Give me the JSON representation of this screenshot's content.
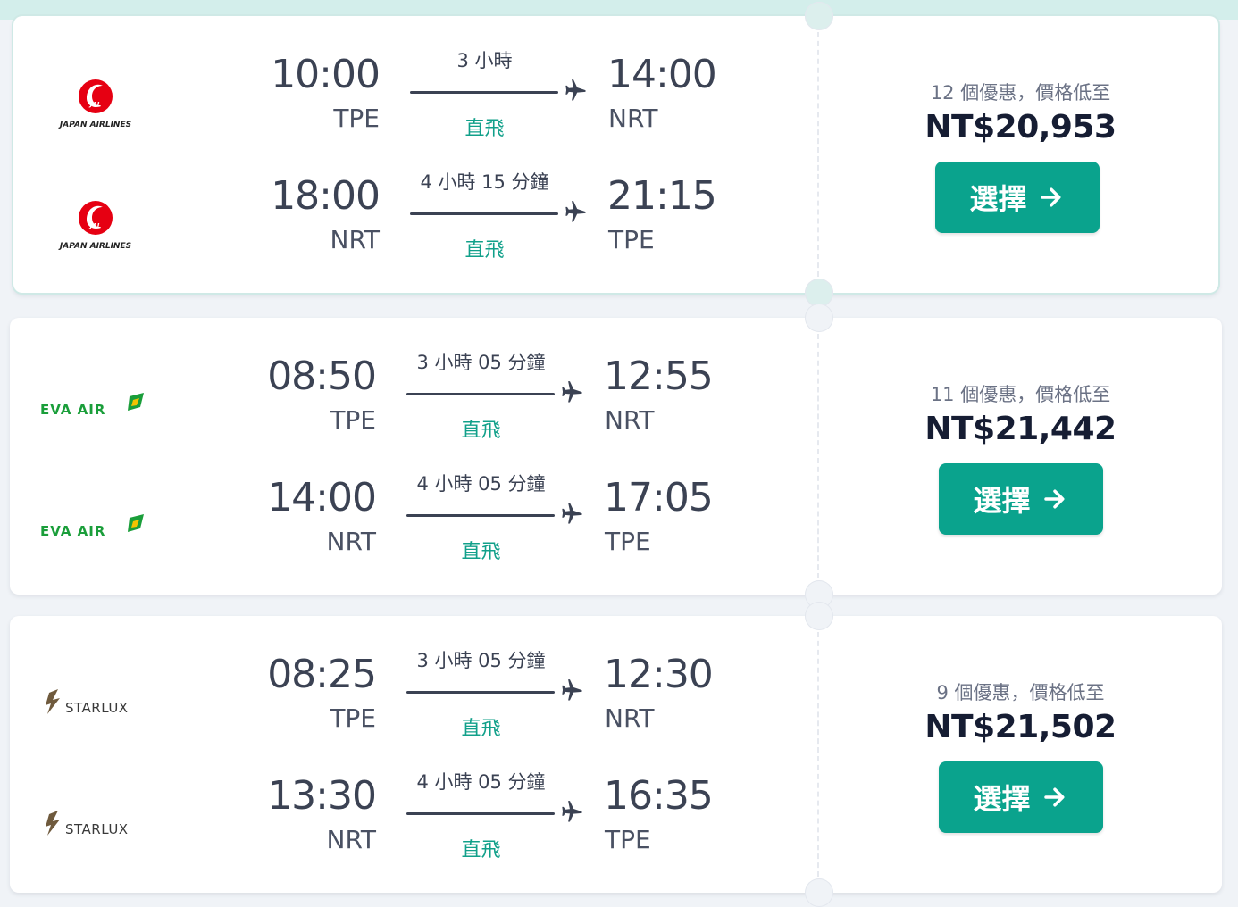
{
  "colors": {
    "accent": "#0aa38d",
    "text_primary": "#3b4253",
    "price_text": "#161d33",
    "stops_text": "#11a08a",
    "jal_red": "#e60012",
    "eva_green": "#1a9e3a",
    "starlux_brown": "#6f5a3d"
  },
  "results": [
    {
      "id": "jal",
      "highlighted": true,
      "airline_logo": "japan-airlines-logo",
      "airline_name": "JAPAN AIRLINES",
      "legs": [
        {
          "dep_time": "10:00",
          "dep_code": "TPE",
          "duration": "3 小時",
          "stops": "直飛",
          "arr_time": "14:00",
          "arr_code": "NRT"
        },
        {
          "dep_time": "18:00",
          "dep_code": "NRT",
          "duration": "4 小時 15 分鐘",
          "stops": "直飛",
          "arr_time": "21:15",
          "arr_code": "TPE"
        }
      ],
      "deals_text": "12 個優惠，價格低至",
      "price": "NT$20,953",
      "select_label": "選擇"
    },
    {
      "id": "eva",
      "highlighted": false,
      "airline_logo": "eva-air-logo",
      "airline_name": "EVA AIR",
      "legs": [
        {
          "dep_time": "08:50",
          "dep_code": "TPE",
          "duration": "3 小時 05 分鐘",
          "stops": "直飛",
          "arr_time": "12:55",
          "arr_code": "NRT"
        },
        {
          "dep_time": "14:00",
          "dep_code": "NRT",
          "duration": "4 小時 05 分鐘",
          "stops": "直飛",
          "arr_time": "17:05",
          "arr_code": "TPE"
        }
      ],
      "deals_text": "11 個優惠，價格低至",
      "price": "NT$21,442",
      "select_label": "選擇"
    },
    {
      "id": "starlux",
      "highlighted": false,
      "airline_logo": "starlux-logo",
      "airline_name": "STARLUX",
      "legs": [
        {
          "dep_time": "08:25",
          "dep_code": "TPE",
          "duration": "3 小時 05 分鐘",
          "stops": "直飛",
          "arr_time": "12:30",
          "arr_code": "NRT"
        },
        {
          "dep_time": "13:30",
          "dep_code": "NRT",
          "duration": "4 小時 05 分鐘",
          "stops": "直飛",
          "arr_time": "16:35",
          "arr_code": "TPE"
        }
      ],
      "deals_text": "9 個優惠，價格低至",
      "price": "NT$21,502",
      "select_label": "選擇"
    }
  ]
}
